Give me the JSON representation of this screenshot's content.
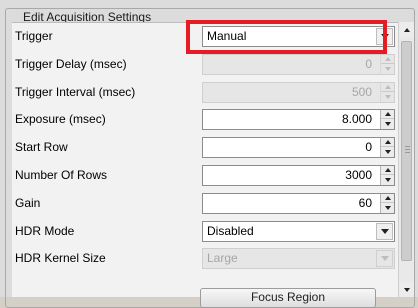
{
  "group": {
    "title": "Edit Acquisition Settings"
  },
  "rows": [
    {
      "label": "Trigger",
      "value": "Manual",
      "control": "combo",
      "enabled": true
    },
    {
      "label": "Trigger Delay (msec)",
      "value": "0",
      "control": "spin",
      "enabled": false
    },
    {
      "label": "Trigger Interval (msec)",
      "value": "500",
      "control": "spin",
      "enabled": false
    },
    {
      "label": "Exposure (msec)",
      "value": "8.000",
      "control": "spin",
      "enabled": true
    },
    {
      "label": "Start Row",
      "value": "0",
      "control": "spin",
      "enabled": true
    },
    {
      "label": "Number Of Rows",
      "value": "3000",
      "control": "spin",
      "enabled": true
    },
    {
      "label": "Gain",
      "value": "60",
      "control": "spin",
      "enabled": true
    },
    {
      "label": "HDR Mode",
      "value": "Disabled",
      "control": "combo",
      "enabled": true
    },
    {
      "label": "HDR Kernel Size",
      "value": "Large",
      "control": "combo",
      "enabled": false
    }
  ],
  "buttons": {
    "focus_region": "Focus Region"
  },
  "colors": {
    "highlight": "#e51c23",
    "panel_bg": "#dcdcdc",
    "grid_bg": "#f2f2f2"
  },
  "icons": {
    "spin_up": "triangle-up-icon",
    "spin_down": "triangle-down-icon",
    "combo": "chevron-down-icon"
  }
}
